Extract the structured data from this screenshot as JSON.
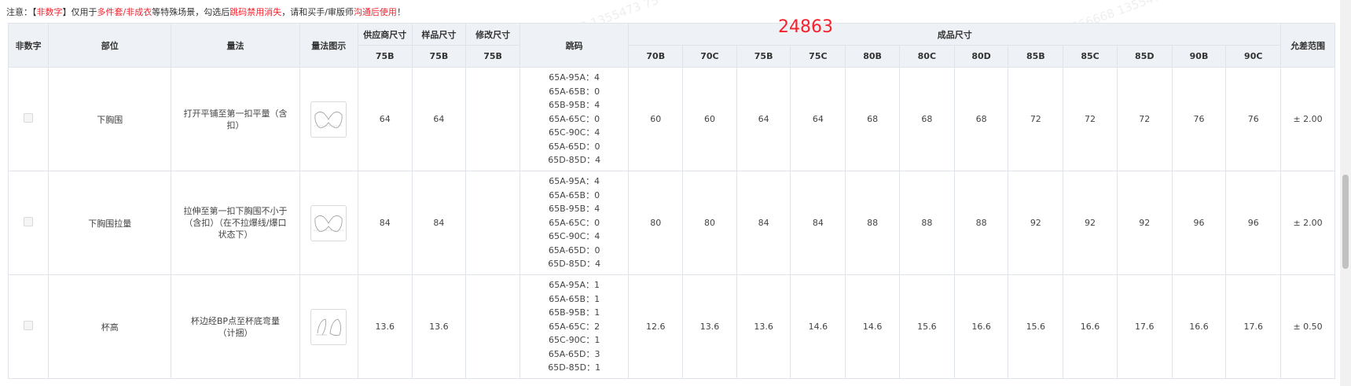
{
  "notice": {
    "prefix": "注意：【",
    "non_numeric": "非数字",
    "mid1": "】仅用于",
    "multi_piece": "多件套/非成衣",
    "mid2": "等特殊场景，勾选后",
    "size_disabled": "跳码禁用消失",
    "mid3": "，请和买手/审版师",
    "communicate": "沟通后使用",
    "suffix": "！"
  },
  "overlay_number": "24863",
  "watermark": "2566668 1355473 75",
  "headers": {
    "non_numeric": "非数字",
    "part": "部位",
    "method": "量法",
    "method_image": "量法图示",
    "supplier_size": "供应商尺寸",
    "sample_size": "样品尺寸",
    "modified_size": "修改尺寸",
    "grading": "跳码",
    "finished_size": "成品尺寸",
    "tolerance": "允差范围",
    "supplier_sub": "75B",
    "sample_sub": "75B",
    "modified_sub": "75B",
    "finished_sizes": [
      "70B",
      "70C",
      "75B",
      "75C",
      "80B",
      "80C",
      "80D",
      "85B",
      "85C",
      "85D",
      "90B",
      "90C"
    ]
  },
  "rows": [
    {
      "part": "下胸围",
      "method": "打开平铺至第一扣平量（含扣）",
      "supplier": "64",
      "sample": "64",
      "modified": "",
      "grading": [
        "65A-95A：4",
        "65A-65B：0",
        "65B-95B：4",
        "65A-65C：0",
        "65C-90C：4",
        "65A-65D：0",
        "65D-85D：4"
      ],
      "finished": [
        "60",
        "60",
        "64",
        "64",
        "68",
        "68",
        "68",
        "72",
        "72",
        "72",
        "76",
        "76"
      ],
      "tolerance": "± 2.00"
    },
    {
      "part": "下胸围拉量",
      "method": "拉伸至第一扣下胸围不小于（含扣）（在不拉爆线/爆口状态下）",
      "supplier": "84",
      "sample": "84",
      "modified": "",
      "grading": [
        "65A-95A：4",
        "65A-65B：0",
        "65B-95B：4",
        "65A-65C：0",
        "65C-90C：4",
        "65A-65D：0",
        "65D-85D：4"
      ],
      "finished": [
        "80",
        "80",
        "84",
        "84",
        "88",
        "88",
        "88",
        "92",
        "92",
        "92",
        "96",
        "96"
      ],
      "tolerance": "± 2.00"
    },
    {
      "part": "杯高",
      "method": "杯边经BP点至杯底弯量（计捆）",
      "supplier": "13.6",
      "sample": "13.6",
      "modified": "",
      "grading": [
        "65A-95A：1",
        "65A-65B：1",
        "65B-95B：1",
        "65A-65C：2",
        "65C-90C：1",
        "65A-65D：3",
        "65D-85D：1"
      ],
      "finished": [
        "12.6",
        "13.6",
        "13.6",
        "14.6",
        "14.6",
        "15.6",
        "16.6",
        "15.6",
        "16.6",
        "17.6",
        "16.6",
        "17.6"
      ],
      "tolerance": "± 0.50"
    }
  ]
}
